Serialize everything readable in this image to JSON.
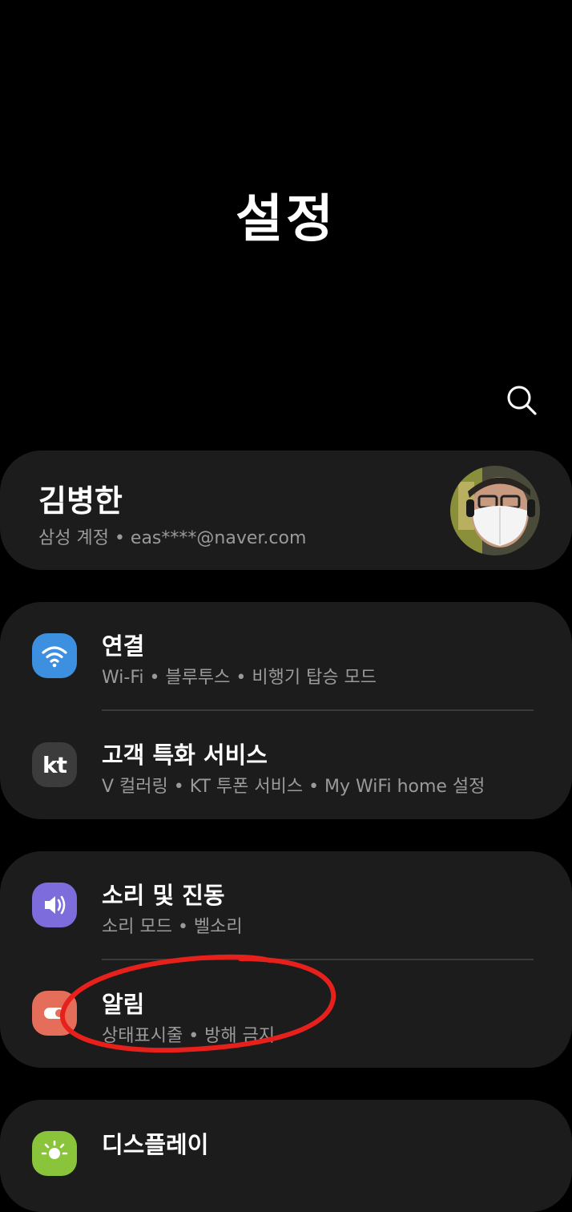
{
  "header": {
    "title": "설정"
  },
  "account": {
    "name": "김병한",
    "subtitle": "삼성 계정  •  eas****@naver.com"
  },
  "groups": [
    {
      "items": [
        {
          "title": "연결",
          "subtitle": "Wi-Fi  •  블루투스  •  비행기 탑승 모드",
          "icon": "wifi-icon",
          "icon_color": "#3d8fe0"
        },
        {
          "title": "고객 특화 서비스",
          "subtitle": "V 컬러링  •  KT 투폰 서비스  •  My WiFi home 설정",
          "icon": "kt-icon",
          "icon_color": "#3c3c3c",
          "icon_text": "kt"
        }
      ]
    },
    {
      "items": [
        {
          "title": "소리 및 진동",
          "subtitle": "소리 모드  •  벨소리",
          "icon": "sound-icon",
          "icon_color": "#7c6cdc"
        },
        {
          "title": "알림",
          "subtitle": "상태표시줄  •  방해 금지",
          "icon": "notification-icon",
          "icon_color": "#e56e5a"
        }
      ]
    },
    {
      "items": [
        {
          "title": "디스플레이",
          "icon": "display-icon",
          "icon_color": "#8ac43a"
        }
      ]
    }
  ],
  "annotation_color": "#e8201c"
}
